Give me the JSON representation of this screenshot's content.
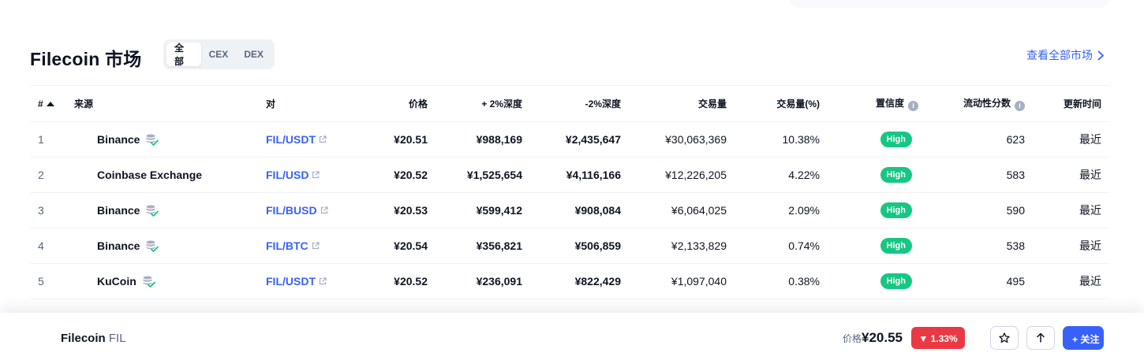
{
  "header": {
    "title": "Filecoin 市场",
    "segments": [
      "全部",
      "CEX",
      "DEX"
    ],
    "active_segment": 0,
    "view_all": "查看全部市场"
  },
  "table": {
    "columns": [
      "#",
      "来源",
      "对",
      "价格",
      "+ 2%深度",
      "-2%深度",
      "交易量",
      "交易量(%)",
      "置信度",
      "流动性分数",
      "更新时间"
    ],
    "rows": [
      {
        "rank": "1",
        "source": "Binance",
        "verified": true,
        "pair": "FIL/USDT",
        "price": "¥20.51",
        "plus2": "¥988,169",
        "minus2": "¥2,435,647",
        "volume": "¥30,063,369",
        "volume_pct": "10.38%",
        "confidence": "High",
        "liquidity": "623",
        "updated": "最近"
      },
      {
        "rank": "2",
        "source": "Coinbase Exchange",
        "verified": false,
        "pair": "FIL/USD",
        "price": "¥20.52",
        "plus2": "¥1,525,654",
        "minus2": "¥4,116,166",
        "volume": "¥12,226,205",
        "volume_pct": "4.22%",
        "confidence": "High",
        "liquidity": "583",
        "updated": "最近"
      },
      {
        "rank": "3",
        "source": "Binance",
        "verified": true,
        "pair": "FIL/BUSD",
        "price": "¥20.53",
        "plus2": "¥599,412",
        "minus2": "¥908,084",
        "volume": "¥6,064,025",
        "volume_pct": "2.09%",
        "confidence": "High",
        "liquidity": "590",
        "updated": "最近"
      },
      {
        "rank": "4",
        "source": "Binance",
        "verified": true,
        "pair": "FIL/BTC",
        "price": "¥20.54",
        "plus2": "¥356,821",
        "minus2": "¥506,859",
        "volume": "¥2,133,829",
        "volume_pct": "0.74%",
        "confidence": "High",
        "liquidity": "538",
        "updated": "最近"
      },
      {
        "rank": "5",
        "source": "KuCoin",
        "verified": true,
        "pair": "FIL/USDT",
        "price": "¥20.52",
        "plus2": "¥236,091",
        "minus2": "¥822,429",
        "volume": "¥1,097,040",
        "volume_pct": "0.38%",
        "confidence": "High",
        "liquidity": "495",
        "updated": "最近"
      }
    ]
  },
  "sticky": {
    "name": "Filecoin",
    "symbol": "FIL",
    "price_label": "价格",
    "price": "¥20.55",
    "change": "▼ 1.33%",
    "follow": "+ 关注"
  },
  "colors": {
    "accent": "#3861fb",
    "high_badge": "#16c784",
    "down_badge": "#ea3943"
  }
}
